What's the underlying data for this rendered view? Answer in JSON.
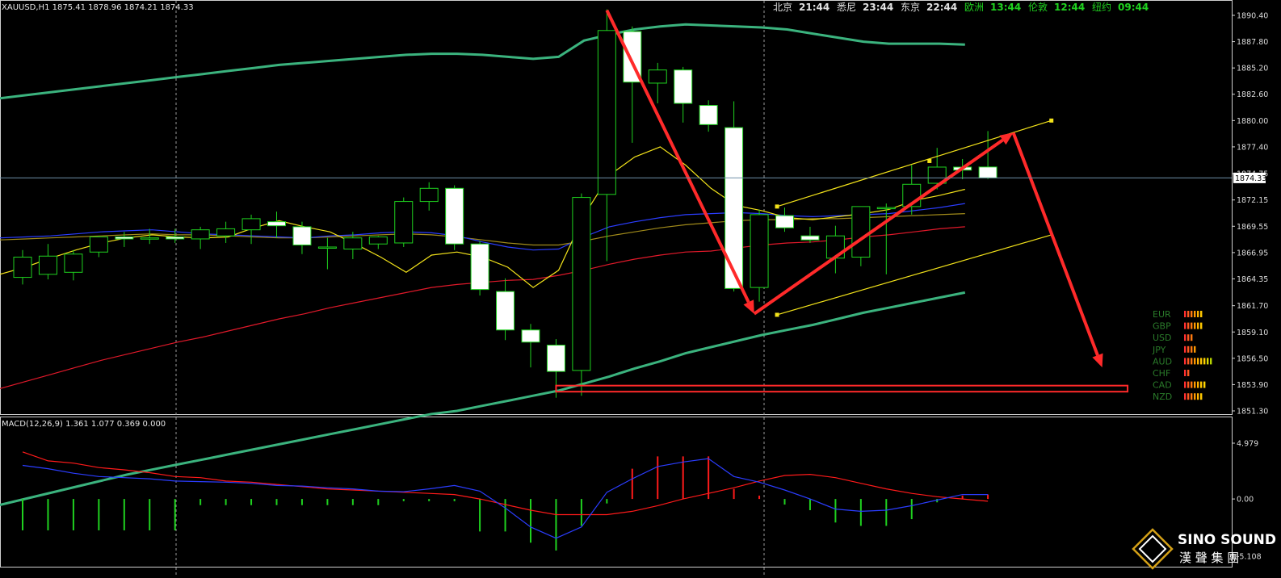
{
  "header": {
    "symbol_info": "XAUUSD,H1  1875.41 1878.96 1874.21 1874.33",
    "macd_info": "MACD(12,26,9) 1.361 1.077 0.369 0.000"
  },
  "sessions": [
    {
      "city": "北京",
      "time": "21:44",
      "color": "#e0e0e0"
    },
    {
      "city": "悉尼",
      "time": "23:44",
      "color": "#e0e0e0"
    },
    {
      "city": "东京",
      "time": "22:44",
      "color": "#e0e0e0"
    },
    {
      "city": "欧洲",
      "time": "13:44",
      "color": "#1fd11f"
    },
    {
      "city": "伦敦",
      "time": "12:44",
      "color": "#1fd11f"
    },
    {
      "city": "纽约",
      "time": "09:44",
      "color": "#1fd11f"
    }
  ],
  "logo": {
    "name": "SINO SOUND",
    "cn": "漢 聲 集 團"
  },
  "strength": [
    {
      "ccy": "EUR",
      "bars": 6
    },
    {
      "ccy": "GBP",
      "bars": 6
    },
    {
      "ccy": "USD",
      "bars": 3
    },
    {
      "ccy": "JPY",
      "bars": 4
    },
    {
      "ccy": "AUD",
      "bars": 9
    },
    {
      "ccy": "CHF",
      "bars": 2
    },
    {
      "ccy": "CAD",
      "bars": 7
    },
    {
      "ccy": "NZD",
      "bars": 6
    }
  ],
  "chart_data": {
    "type": "candlestick",
    "price_axis_labels": [
      "1890.40",
      "1887.80",
      "1885.20",
      "1882.60",
      "1880.00",
      "1877.40",
      "1874.75",
      "1872.15",
      "1869.55",
      "1866.95",
      "1864.35",
      "1861.70",
      "1859.10",
      "1856.50",
      "1853.90",
      "1851.30"
    ],
    "current_price_label": "1874.33",
    "current_price": 1874.33,
    "ylim": [
      1851.3,
      1890.4
    ],
    "macd_axis_labels": [
      "4.979",
      "0.00",
      "-5.108"
    ],
    "macd_ylim": [
      -5.108,
      4.979
    ],
    "candles": [
      {
        "o": 1864.5,
        "h": 1867.2,
        "l": 1863.8,
        "c": 1866.5
      },
      {
        "o": 1864.8,
        "h": 1867.8,
        "l": 1864.3,
        "c": 1866.6
      },
      {
        "o": 1865.0,
        "h": 1867.2,
        "l": 1864.2,
        "c": 1866.8
      },
      {
        "o": 1867.0,
        "h": 1868.6,
        "l": 1866.5,
        "c": 1868.5
      },
      {
        "o": 1868.5,
        "h": 1869.0,
        "l": 1867.5,
        "c": 1868.3
      },
      {
        "o": 1868.3,
        "h": 1869.3,
        "l": 1867.8,
        "c": 1868.4
      },
      {
        "o": 1868.5,
        "h": 1869.3,
        "l": 1867.9,
        "c": 1868.3
      },
      {
        "o": 1868.3,
        "h": 1869.5,
        "l": 1867.3,
        "c": 1869.2
      },
      {
        "o": 1868.6,
        "h": 1870.0,
        "l": 1867.9,
        "c": 1869.3
      },
      {
        "o": 1869.2,
        "h": 1870.7,
        "l": 1867.8,
        "c": 1870.3
      },
      {
        "o": 1870.0,
        "h": 1871.0,
        "l": 1868.4,
        "c": 1869.6
      },
      {
        "o": 1869.5,
        "h": 1870.0,
        "l": 1866.8,
        "c": 1867.7
      },
      {
        "o": 1867.5,
        "h": 1868.4,
        "l": 1865.3,
        "c": 1867.5
      },
      {
        "o": 1867.3,
        "h": 1869.0,
        "l": 1866.3,
        "c": 1868.4
      },
      {
        "o": 1867.8,
        "h": 1868.6,
        "l": 1867.3,
        "c": 1868.5
      },
      {
        "o": 1867.9,
        "h": 1872.4,
        "l": 1867.5,
        "c": 1872.0
      },
      {
        "o": 1872.0,
        "h": 1873.9,
        "l": 1871.1,
        "c": 1873.3
      },
      {
        "o": 1873.3,
        "h": 1873.6,
        "l": 1867.2,
        "c": 1867.8
      },
      {
        "o": 1867.8,
        "h": 1868.1,
        "l": 1862.7,
        "c": 1863.3
      },
      {
        "o": 1863.1,
        "h": 1864.4,
        "l": 1858.3,
        "c": 1859.3
      },
      {
        "o": 1859.3,
        "h": 1859.9,
        "l": 1855.6,
        "c": 1858.1
      },
      {
        "o": 1857.8,
        "h": 1858.4,
        "l": 1852.6,
        "c": 1855.2
      },
      {
        "o": 1855.3,
        "h": 1872.8,
        "l": 1852.8,
        "c": 1872.4
      },
      {
        "o": 1872.7,
        "h": 1891.0,
        "l": 1866.1,
        "c": 1888.9
      },
      {
        "o": 1888.8,
        "h": 1889.3,
        "l": 1877.8,
        "c": 1883.8
      },
      {
        "o": 1883.7,
        "h": 1885.7,
        "l": 1881.7,
        "c": 1885.0
      },
      {
        "o": 1885.0,
        "h": 1885.3,
        "l": 1879.8,
        "c": 1881.7
      },
      {
        "o": 1881.5,
        "h": 1882.0,
        "l": 1878.9,
        "c": 1879.6
      },
      {
        "o": 1879.3,
        "h": 1881.9,
        "l": 1863.1,
        "c": 1863.4
      },
      {
        "o": 1863.5,
        "h": 1871.2,
        "l": 1862.1,
        "c": 1870.7
      },
      {
        "o": 1870.6,
        "h": 1871.4,
        "l": 1869.0,
        "c": 1869.4
      },
      {
        "o": 1868.6,
        "h": 1869.5,
        "l": 1867.9,
        "c": 1868.2
      },
      {
        "o": 1866.4,
        "h": 1869.6,
        "l": 1864.9,
        "c": 1868.6
      },
      {
        "o": 1866.5,
        "h": 1871.5,
        "l": 1865.6,
        "c": 1871.5
      },
      {
        "o": 1871.3,
        "h": 1871.8,
        "l": 1864.8,
        "c": 1871.4
      },
      {
        "o": 1871.5,
        "h": 1875.6,
        "l": 1870.7,
        "c": 1873.7
      },
      {
        "o": 1873.8,
        "h": 1877.3,
        "l": 1873.2,
        "c": 1875.4
      },
      {
        "o": 1875.4,
        "h": 1876.2,
        "l": 1874.2,
        "c": 1875.1
      },
      {
        "o": 1875.41,
        "h": 1878.96,
        "l": 1874.21,
        "c": 1874.33
      }
    ],
    "macd_hist": [
      -2.8,
      -2.8,
      -2.8,
      -2.8,
      -2.8,
      -2.8,
      -2.8,
      -0.55,
      -0.55,
      -0.55,
      -0.55,
      -0.55,
      -0.55,
      -0.55,
      -0.55,
      -0.2,
      -0.2,
      -0.2,
      -2.9,
      -2.9,
      -3.9,
      -4.6,
      -2.4,
      -0.4,
      2.7,
      3.8,
      3.8,
      3.8,
      0.9,
      0.3,
      -0.5,
      -1.0,
      -2.1,
      -2.4,
      -2.4,
      -1.8,
      -0.3,
      0.3,
      0.4
    ],
    "macd_line": [
      3.0,
      2.7,
      2.3,
      2.0,
      1.9,
      1.8,
      1.6,
      1.55,
      1.5,
      1.4,
      1.2,
      1.15,
      1.0,
      0.9,
      0.7,
      0.65,
      0.9,
      1.2,
      0.7,
      -0.8,
      -2.5,
      -3.5,
      -2.5,
      0.6,
      1.8,
      2.9,
      3.3,
      3.6,
      2.0,
      1.5,
      0.8,
      0.0,
      -0.9,
      -1.1,
      -1.0,
      -0.6,
      -0.1,
      0.4,
      0.4
    ],
    "signal_line": [
      4.2,
      3.4,
      3.2,
      2.8,
      2.6,
      2.35,
      2.0,
      1.9,
      1.6,
      1.5,
      1.3,
      1.1,
      0.9,
      0.8,
      0.7,
      0.6,
      0.5,
      0.4,
      0.0,
      -0.5,
      -1.0,
      -1.4,
      -1.4,
      -1.4,
      -1.1,
      -0.6,
      0.0,
      0.5,
      1.0,
      1.6,
      2.1,
      2.2,
      1.9,
      1.4,
      0.9,
      0.5,
      0.2,
      0.0,
      -0.2
    ],
    "bb_upper": [
      1882.2,
      1882.5,
      1882.8,
      1883.1,
      1883.4,
      1883.7,
      1884.0,
      1884.3,
      1884.6,
      1884.9,
      1885.2,
      1885.5,
      1885.7,
      1885.9,
      1886.1,
      1886.3,
      1886.5,
      1886.6,
      1886.6,
      1886.5,
      1886.3,
      1886.1,
      1886.3,
      1887.9,
      1888.5,
      1889.0,
      1889.3,
      1889.5,
      1889.4,
      1889.3,
      1889.2,
      1889.0,
      1888.6,
      1888.2,
      1887.8,
      1887.6,
      1887.6,
      1887.6,
      1887.5
    ],
    "bb_lower": [
      1842.0,
      1842.6,
      1843.2,
      1843.8,
      1844.4,
      1845.0,
      1845.5,
      1846.0,
      1846.5,
      1847.0,
      1847.5,
      1848.0,
      1848.5,
      1849.0,
      1849.5,
      1850.0,
      1850.5,
      1851.0,
      1851.3,
      1851.8,
      1852.3,
      1852.8,
      1853.3,
      1854.0,
      1854.7,
      1855.5,
      1856.2,
      1857.0,
      1857.6,
      1858.2,
      1858.8,
      1859.3,
      1859.8,
      1860.4,
      1861.0,
      1861.5,
      1862.0,
      1862.5,
      1863.0
    ],
    "ma_red": [
      1853.5,
      1854.2,
      1854.9,
      1855.6,
      1856.3,
      1856.9,
      1857.5,
      1858.1,
      1858.6,
      1859.2,
      1859.8,
      1860.4,
      1860.9,
      1861.5,
      1862.0,
      1862.5,
      1863.0,
      1863.5,
      1863.8,
      1864.0,
      1864.2,
      1864.3,
      1864.7,
      1865.2,
      1865.8,
      1866.3,
      1866.7,
      1867.0,
      1867.1,
      1867.4,
      1867.7,
      1867.9,
      1868.0,
      1868.2,
      1868.5,
      1868.7,
      1869.0,
      1869.3,
      1869.5
    ],
    "ma_blue": [
      1868.4,
      1868.5,
      1868.6,
      1868.8,
      1869.0,
      1869.1,
      1869.2,
      1869.0,
      1868.8,
      1868.7,
      1868.6,
      1868.5,
      1868.4,
      1868.6,
      1868.7,
      1868.9,
      1869.0,
      1868.9,
      1868.6,
      1868.0,
      1867.5,
      1867.2,
      1867.3,
      1868.5,
      1869.5,
      1870.0,
      1870.4,
      1870.7,
      1870.8,
      1870.9,
      1870.8,
      1870.6,
      1870.5,
      1870.6,
      1870.7,
      1870.8,
      1871.1,
      1871.4,
      1871.8
    ],
    "ma_olive": [
      1868.2,
      1868.3,
      1868.4,
      1868.5,
      1868.6,
      1868.7,
      1868.8,
      1868.7,
      1868.7,
      1868.6,
      1868.5,
      1868.4,
      1868.4,
      1868.5,
      1868.6,
      1868.7,
      1868.8,
      1868.7,
      1868.5,
      1868.2,
      1867.9,
      1867.7,
      1867.7,
      1868.1,
      1868.6,
      1869.0,
      1869.4,
      1869.7,
      1869.9,
      1870.1,
      1870.2,
      1870.2,
      1870.3,
      1870.3,
      1870.4,
      1870.5,
      1870.6,
      1870.7,
      1870.8
    ],
    "ma_yellow": [
      1864.8,
      1865.5,
      1866.4,
      1867.2,
      1867.9,
      1868.4,
      1868.7,
      1868.5,
      1868.4,
      1868.5,
      1869.4,
      1870.1,
      1869.5,
      1869.0,
      1867.8,
      1866.5,
      1865.0,
      1866.7,
      1867.0,
      1866.5,
      1865.5,
      1863.5,
      1865.2,
      1870.6,
      1874.6,
      1876.4,
      1877.4,
      1875.6,
      1873.3,
      1871.6,
      1871.1,
      1870.4,
      1870.2,
      1870.5,
      1870.8,
      1871.2,
      1872.1,
      1872.6,
      1873.2
    ],
    "channel_upper": {
      "from": [
        29.7,
        1871.5
      ],
      "to": [
        40.5,
        1880.0
      ]
    },
    "channel_lower": {
      "from": [
        29.7,
        1860.8
      ],
      "to": [
        40.5,
        1868.7
      ]
    },
    "channel_upper_midpoint": [
      35.7,
      1876.0
    ],
    "arrows": [
      {
        "from": [
          23.0,
          1890.9
        ],
        "to": [
          28.8,
          1860.9
        ]
      },
      {
        "from": [
          28.8,
          1860.9
        ],
        "to": [
          39.0,
          1878.8
        ]
      },
      {
        "from": [
          39.0,
          1878.8
        ],
        "to": [
          42.5,
          1855.6
        ]
      }
    ],
    "support_zone": {
      "x_from": 21.0,
      "x_to": 43.5,
      "y_low": 1853.2,
      "y_high": 1853.8
    }
  }
}
